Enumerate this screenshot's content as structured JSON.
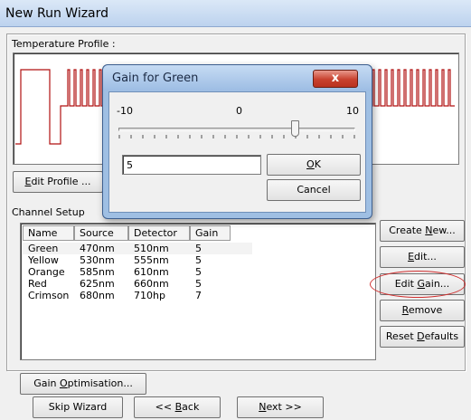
{
  "window": {
    "title": "New Run Wizard"
  },
  "temperature_profile": {
    "label": "Temperature Profile :"
  },
  "edit_profile": {
    "label_prefix": "E",
    "label_rest": "dit Profile ..."
  },
  "channel_setup": {
    "label": "Channel Setup",
    "columns": [
      "Name",
      "Source",
      "Detector",
      "Gain"
    ],
    "rows": [
      [
        "Green",
        "470nm",
        "510nm",
        "5"
      ],
      [
        "Yellow",
        "530nm",
        "555nm",
        "5"
      ],
      [
        "Orange",
        "585nm",
        "610nm",
        "5"
      ],
      [
        "Red",
        "625nm",
        "660nm",
        "5"
      ],
      [
        "Crimson",
        "680nm",
        "710hp",
        "7"
      ]
    ]
  },
  "side_buttons": {
    "create_new": {
      "pre": "Create ",
      "key": "N",
      "post": "ew..."
    },
    "edit": {
      "pre": "",
      "key": "E",
      "post": "dit..."
    },
    "edit_gain": {
      "pre": "Edit ",
      "key": "G",
      "post": "ain..."
    },
    "remove": {
      "pre": "",
      "key": "R",
      "post": "emove"
    },
    "reset_defaults": {
      "pre": "Reset ",
      "key": "D",
      "post": "efaults"
    }
  },
  "gain_optimisation": {
    "pre": "Gain ",
    "key": "O",
    "post": "ptimisation..."
  },
  "nav": {
    "skip": "Skip Wizard",
    "back": {
      "pre": "<< ",
      "key": "B",
      "post": "ack"
    },
    "next": {
      "pre": "",
      "key": "N",
      "post": "ext >>"
    }
  },
  "dialog": {
    "title": "Gain for Green",
    "close": "x",
    "scale_min": "-10",
    "scale_mid": "0",
    "scale_max": "10",
    "slider_value": 5,
    "slider_min": -10,
    "slider_max": 10,
    "input_value": "5",
    "ok": {
      "key": "O",
      "post": "K"
    },
    "cancel": "Cancel"
  },
  "colors": {
    "highlight": "#d03030",
    "dialog_frame": "#9fbfe3",
    "waveform": "#b01010"
  }
}
